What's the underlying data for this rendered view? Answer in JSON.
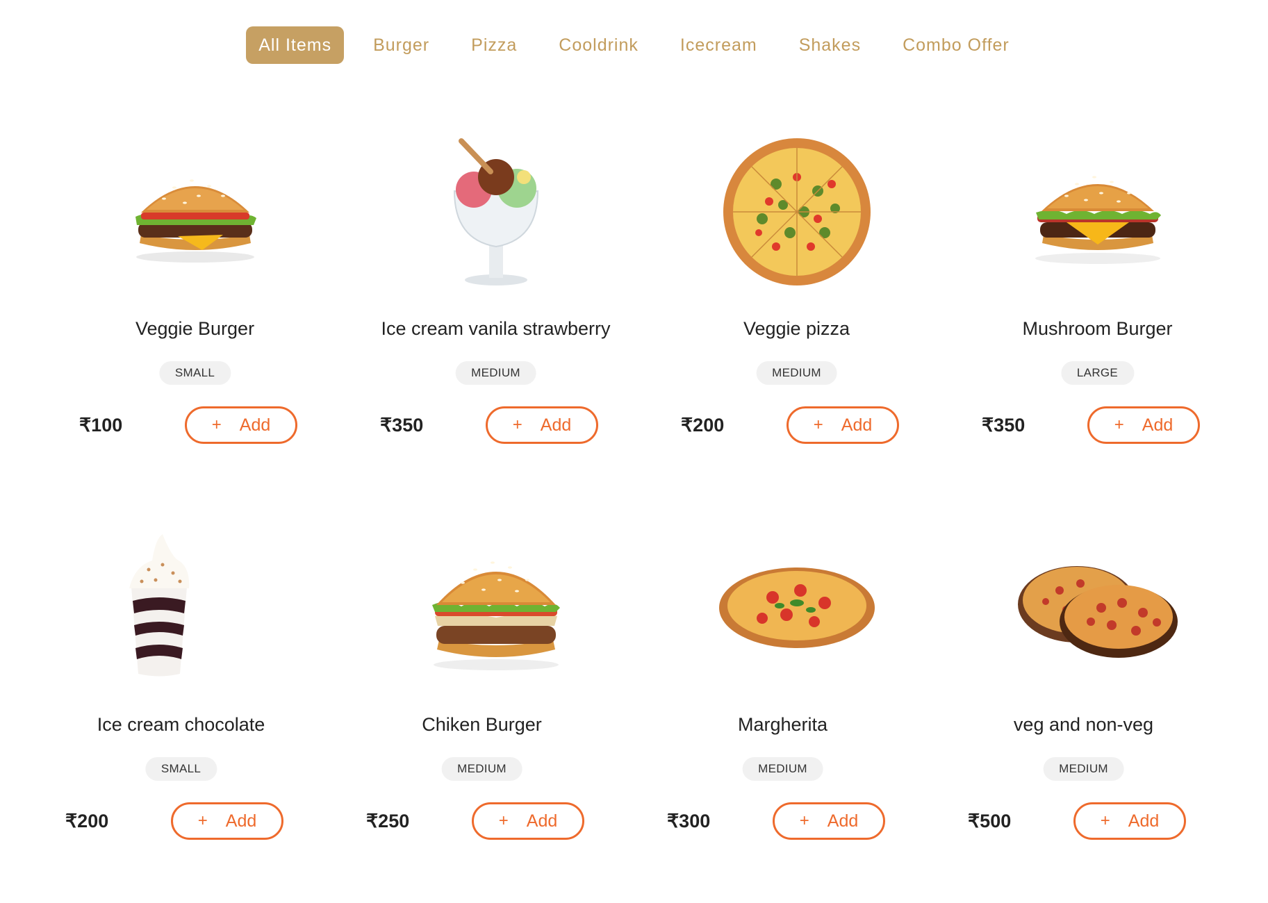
{
  "tabs": [
    {
      "label": "All Items",
      "active": true
    },
    {
      "label": "Burger"
    },
    {
      "label": "Pizza"
    },
    {
      "label": "Cooldrink"
    },
    {
      "label": "Icecream"
    },
    {
      "label": "Shakes"
    },
    {
      "label": "Combo Offer"
    }
  ],
  "add_button": {
    "plus": "+",
    "label": "Add"
  },
  "products": [
    {
      "name": "Veggie Burger",
      "size": "SMALL",
      "price": "₹100",
      "image": "burger-image"
    },
    {
      "name": "Ice cream vanila strawberry",
      "size": "MEDIUM",
      "price": "₹350",
      "image": "ice-cream-sundae-image"
    },
    {
      "name": "Veggie pizza",
      "size": "MEDIUM",
      "price": "₹200",
      "image": "veggie-pizza-image"
    },
    {
      "name": "Mushroom Burger",
      "size": "LARGE",
      "price": "₹350",
      "image": "cheese-burger-image"
    },
    {
      "name": "Ice cream chocolate",
      "size": "SMALL",
      "price": "₹200",
      "image": "chocolate-sundae-image"
    },
    {
      "name": "Chiken Burger",
      "size": "MEDIUM",
      "price": "₹250",
      "image": "chicken-burger-image"
    },
    {
      "name": "Margherita",
      "size": "MEDIUM",
      "price": "₹300",
      "image": "margherita-pizza-image"
    },
    {
      "name": "veg and non-veg",
      "size": "MEDIUM",
      "price": "₹500",
      "image": "pepperoni-pizzas-image"
    }
  ]
}
